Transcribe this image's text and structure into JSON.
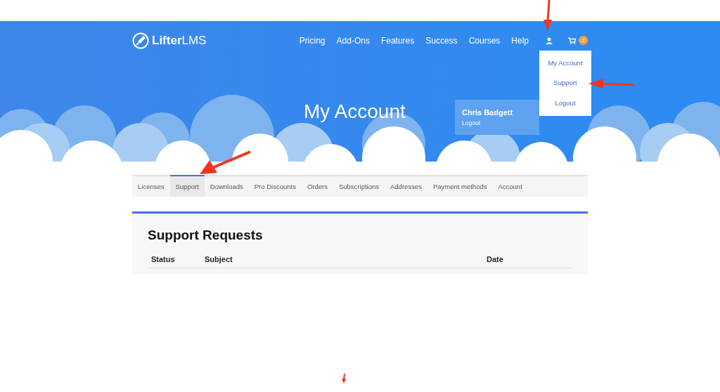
{
  "brand": {
    "name": "**Lifter**LMS"
  },
  "nav": {
    "items": [
      {
        "label": "Pricing"
      },
      {
        "label": "Add-Ons"
      },
      {
        "label": "Features"
      },
      {
        "label": "Success"
      },
      {
        "label": "Courses"
      },
      {
        "label": "Help"
      }
    ],
    "cart_count": "2"
  },
  "user_menu": {
    "open": true,
    "items": [
      {
        "label": "My Account"
      },
      {
        "label": "Support"
      },
      {
        "label": "Logout"
      }
    ]
  },
  "page_title": "My Account",
  "profile": {
    "name": "Chris Badgett",
    "logout": "Logout"
  },
  "tabs": [
    {
      "label": "Licenses",
      "selected": false
    },
    {
      "label": "Support",
      "selected": true
    },
    {
      "label": "Downloads",
      "selected": false
    },
    {
      "label": "Pro Discounts",
      "selected": false
    },
    {
      "label": "Orders",
      "selected": false
    },
    {
      "label": "Subscriptions",
      "selected": false
    },
    {
      "label": "Addresses",
      "selected": false
    },
    {
      "label": "Payment methods",
      "selected": false
    },
    {
      "label": "Account",
      "selected": false
    }
  ],
  "panel": {
    "title": "Support Requests",
    "columns": [
      "Status",
      "Subject",
      "Date"
    ]
  }
}
